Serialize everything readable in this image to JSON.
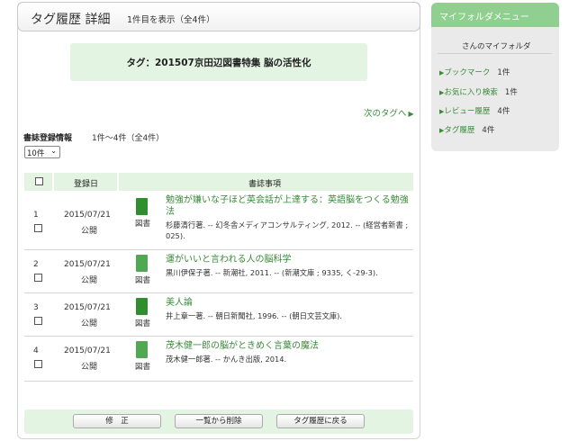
{
  "header": {
    "title": "タグ履歴 詳細",
    "count_text": "1件目を表示（全4件）"
  },
  "tag": {
    "label": "タグ：201507京田辺図書特集 脳の活性化"
  },
  "next_tag_link": "次のタグへ",
  "biblio": {
    "title": "書誌登録情報",
    "range": "1件～4件（全4件）",
    "per_page": "10件"
  },
  "table": {
    "headers": {
      "date": "登録日",
      "info": "書誌事項"
    },
    "rows": [
      {
        "num": "1",
        "date": "2015/07/21",
        "visibility": "公開",
        "type": "図書",
        "title": "勉強が嫌いな子ほど英会話が上達する：英語脳をつくる勉強法",
        "meta": "杉藤清行著. -- 幻冬舎メディアコンサルティング, 2012. -- (経営者新書 ; 025)."
      },
      {
        "num": "2",
        "date": "2015/07/21",
        "visibility": "公開",
        "type": "図書",
        "title": "運がいいと言われる人の脳科学",
        "meta": "黒川伊保子著. -- 新潮社, 2011. -- (新潮文庫 ; 9335, く-29-3)."
      },
      {
        "num": "3",
        "date": "2015/07/21",
        "visibility": "公開",
        "type": "図書",
        "title": "美人論",
        "meta": "井上章一著. -- 朝日新聞社, 1996. -- (朝日文芸文庫)."
      },
      {
        "num": "4",
        "date": "2015/07/21",
        "visibility": "公開",
        "type": "図書",
        "title": "茂木健一郎の脳がときめく言葉の魔法",
        "meta": "茂木健一郎著. -- かんき出版, 2014."
      }
    ]
  },
  "buttons": {
    "edit": "修　正",
    "delete": "一覧から削除",
    "back": "タグ履歴に戻る"
  },
  "sidebar": {
    "title": "マイフォルダメニュー",
    "user_text": "さんのマイフォルダ",
    "items": [
      {
        "label": "ブックマーク",
        "count": "1件"
      },
      {
        "label": "お気に入り検索",
        "count": "1件"
      },
      {
        "label": "レビュー履歴",
        "count": "4件"
      },
      {
        "label": "タグ履歴",
        "count": "4件"
      }
    ]
  },
  "colors": {
    "accent_green": "#8fcf8f",
    "link_green": "#3a8a3a",
    "panel_light_green": "#e3f4e3",
    "book_icon_green": "#2f8f2f"
  },
  "icons": {
    "book": "book-icon",
    "triangle": "triangle-right-icon",
    "select_arrow": "chevron-down-icon"
  }
}
